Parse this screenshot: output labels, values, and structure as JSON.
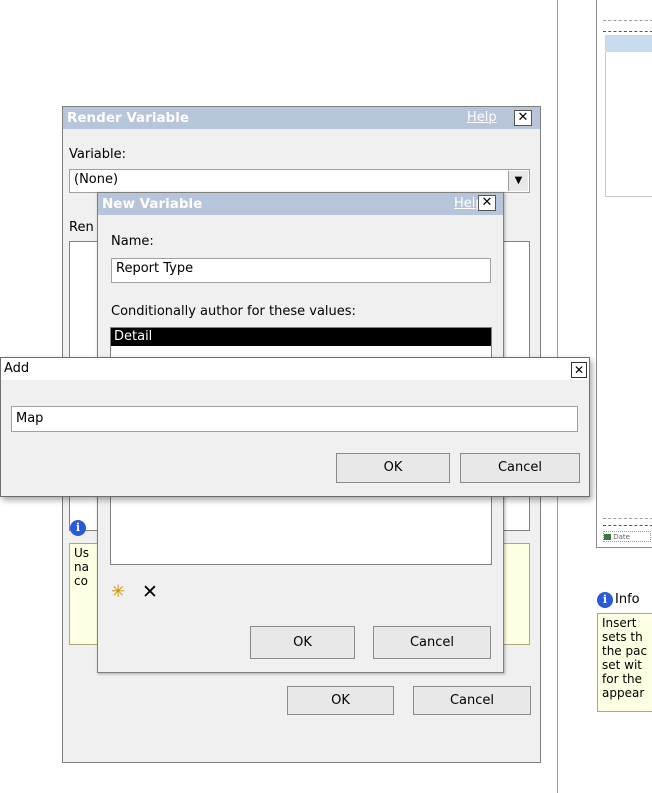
{
  "right_pane": {
    "date_label": "Date",
    "info_title": "Info",
    "info_lines": [
      "Insert",
      "sets th",
      "the pac",
      "set wit",
      "for the",
      "appear"
    ]
  },
  "render_variable": {
    "title": "Render Variable",
    "help": "Help",
    "variable_label": "Variable:",
    "variable_value": "(None)",
    "render_label_partial": "Ren",
    "hint_lines": [
      "Us",
      "na",
      "co"
    ],
    "ok": "OK",
    "cancel": "Cancel"
  },
  "new_variable": {
    "title": "New Variable",
    "help": "Help",
    "name_label": "Name:",
    "name_value": "Report Type",
    "values_label": "Conditionally author for these values:",
    "values": [
      "Detail"
    ],
    "ok": "OK",
    "cancel": "Cancel"
  },
  "add_dialog": {
    "title": "Add",
    "value": "Map",
    "ok": "OK",
    "cancel": "Cancel"
  }
}
